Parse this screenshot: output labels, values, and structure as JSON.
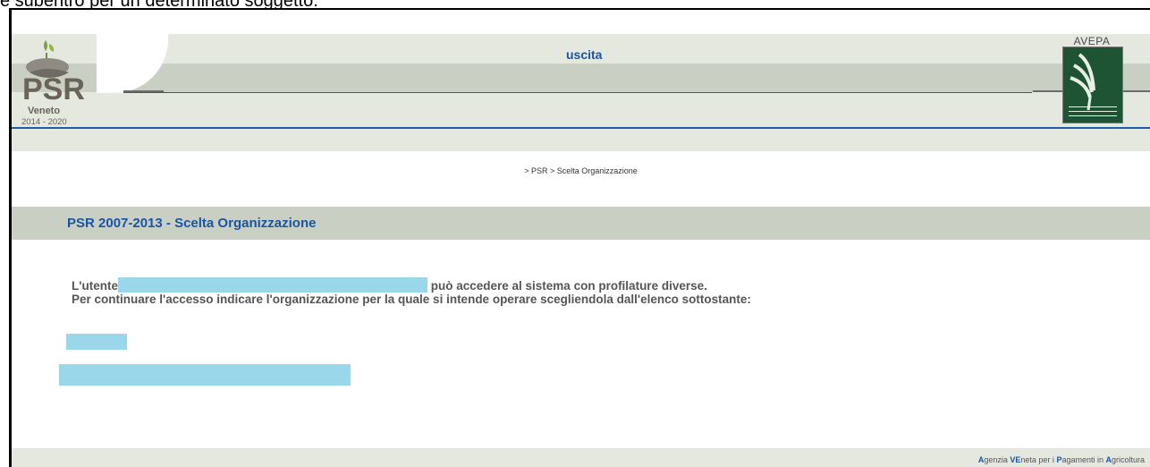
{
  "caption": {
    "text": "e subentro per un determinato soggetto."
  },
  "header": {
    "logo_left": {
      "title": "PSR",
      "region": "Veneto",
      "years": "2014 - 2020"
    },
    "exit_link": "uscita",
    "logo_right": {
      "title": "AVEPA"
    }
  },
  "breadcrumb": "> PSR > Scelta Organizzazione",
  "page": {
    "title": "PSR 2007-2013 - Scelta Organizzazione",
    "message_prefix": "L'utente",
    "message_suffix": "può accedere al sistema con profilature diverse.",
    "message_line2": "Per continuare l'accesso indicare l'organizzazione per la quale si intende operare scegliendola dall'elenco sottostante:"
  },
  "footer": {
    "parts": [
      {
        "cap": "A",
        "rest": "genzia "
      },
      {
        "cap": "VE",
        "rest": "neta per i "
      },
      {
        "cap": "P",
        "rest": "agamenti in "
      },
      {
        "cap": "A",
        "rest": "gricoltura"
      }
    ]
  },
  "colors": {
    "accent": "#1a55a3",
    "band_light": "#e4e8df",
    "band_dark": "#c9d0c3",
    "redaction": "#9ad7ea",
    "avepa_green": "#1e5333"
  }
}
